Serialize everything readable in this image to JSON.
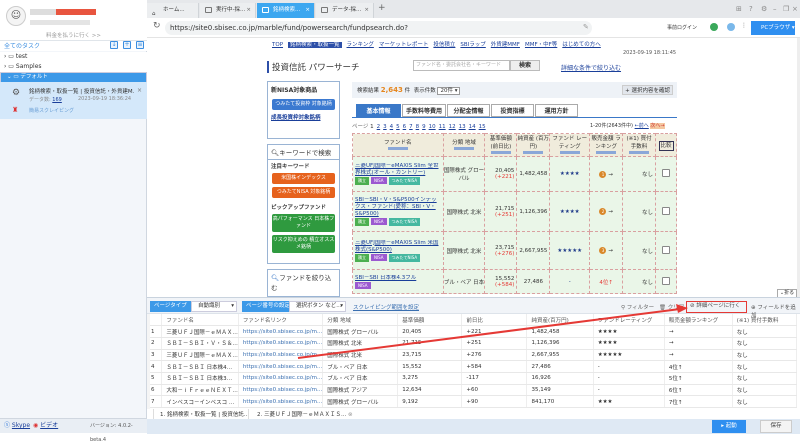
{
  "sidebar": {
    "pay_link": "料金を払うに行く >>",
    "all_tasks": "全てのタスク",
    "folders": [
      "test",
      "Samples",
      "デフォルト"
    ],
    "task": {
      "title": "銘柄検索・取扱一覧 | 投資信託・外貨建M...",
      "data_label": "データ数:",
      "data_count": "169",
      "time": "2023-09-19 18:36:24",
      "type": "簡易スクレイピング"
    },
    "skype": "Skype",
    "video": "ビデオ",
    "version": "バージョン: 4.0.2-beta.4"
  },
  "browser": {
    "tabs": [
      "ホーム...",
      "実行中-採...",
      "銘柄検索...",
      "データ-採..."
    ],
    "active_tab": 2,
    "url": "https://site0.sbisec.co.jp/marble/fund/powersearch/fundpsearch.do?",
    "prelogin": "事前ログイン",
    "pc_browser": "PCブラウザ"
  },
  "page": {
    "nav": [
      "TOP",
      "銘柄検索・取扱一覧",
      "ランキング",
      "マーケットレポート",
      "投信積立",
      "SBIラップ",
      "外貨建MMF",
      "MMF・中F等",
      "はじめての方へ"
    ],
    "date": "2023-09-19 18:11:45",
    "title": "投資信託 パワーサーチ",
    "search_placeholder": "ファンド名・委託会社名・キーワード",
    "search_btn": "検索",
    "detail_link": "詳細な条件で絞り込む",
    "nisa_title": "新NISA対象商品",
    "nisa_btn": "つみたて投資枠 対象銘柄",
    "growth_link": "成長投資枠対象銘柄",
    "keyword_title": "キーワードで検索",
    "attention": "注目キーワード",
    "kw_btns": [
      "米国株インデックス",
      "つみたてNISA 対象銘柄"
    ],
    "pickup": "ピックアップファンド",
    "pick_btns": [
      "高パフォーマンス 日本株ファンド",
      "リスク抑えめの 積立オススメ銘柄"
    ],
    "narrow": "ファンドを絞り込む",
    "result_label": "検索結果",
    "result_count": "2,643",
    "result_unit": "件",
    "display_label": "表示件数",
    "display_value": "20件",
    "confirm_btn": "選択内容を確認",
    "tabs": [
      "基本情報",
      "手数料等費用",
      "分配金情報",
      "投資指標",
      "運用方針"
    ],
    "pager_label": "ページ",
    "pages": [
      "1",
      "2",
      "3",
      "4",
      "5",
      "6",
      "7",
      "8",
      "9",
      "10",
      "11",
      "12",
      "13",
      "14",
      "15"
    ],
    "range": "1-20件(2643件中)",
    "prev": "←前へ",
    "next": "次へ→",
    "headers": [
      "ファンド名",
      "分類 地域",
      "基準価額 (前日比)",
      "純資産 (百万円)",
      "ファンド レーティング",
      "販売金額 ランキング",
      "(※1) 買付 手数料",
      "比較"
    ],
    "rows": [
      {
        "name": "三菱UFJ国際－eMAXIS Slim 全世界株式(オール・カントリー)",
        "badges": [
          "積立",
          "NISA",
          "つみたてNISA"
        ],
        "cat": "国際株式 グローバル",
        "price": "20,405",
        "chg": "(+221)",
        "assets": "1,482,458",
        "rating": "★★★★",
        "rank": "1",
        "arrow": "→",
        "fee": "なし"
      },
      {
        "name": "SBI－SBI・V・S&P500インデックス・ファンド(愛称：SBI・V・S&P500)",
        "badges": [
          "積立",
          "NISA",
          "つみたてNISA"
        ],
        "cat": "国際株式 北米",
        "price": "21,715",
        "chg": "(+251)",
        "assets": "1,126,396",
        "rating": "★★★★",
        "rank": "2",
        "arrow": "→",
        "fee": "なし"
      },
      {
        "name": "三菱UFJ国際－eMAXIS Slim 米国株式(S&P500)",
        "badges": [
          "積立",
          "NISA",
          "つみたてNISA"
        ],
        "cat": "国際株式 北米",
        "price": "23,715",
        "chg": "(+276)",
        "assets": "2,667,955",
        "rating": "★★★★★",
        "rank": "3",
        "arrow": "→",
        "fee": "なし"
      },
      {
        "name": "SBI－SBI 日本株4.3ブル",
        "badges": [
          "NISA"
        ],
        "cat": "ブル・ベア 日本",
        "price": "15,552",
        "chg": "(+584)",
        "assets": "27,486",
        "rating": "-",
        "rank": "4位↑",
        "arrow": "",
        "fee": "なし"
      }
    ]
  },
  "panel": {
    "page_type_label": "ページタイプ",
    "page_type": "自動識別",
    "pagenum_label": "ページ番号の設定",
    "pagenum": "選択ボタン など...",
    "scrape_link": "スクレイピング範囲を設定",
    "collapse": "折る",
    "filter": "フィルター",
    "clear": "クリア",
    "goto_detail": "詳細ページに行く",
    "add_field": "フィールドを追加",
    "columns": [
      "",
      "ファンド名",
      "ファンド名リンク",
      "分類 地域",
      "基準価額",
      "前日比",
      "純資産(百万円)",
      "ファンドレーティング",
      "販売金額ランキング",
      "(※1) 買付手数料"
    ],
    "rows": [
      [
        "1",
        "三菱ＵＦＪ国際－ｅＭＡＸ…",
        "https://site0.sbisec.co.jp/m...",
        "国際株式 グローバル",
        "20,405",
        "+221",
        "1,482,458",
        "★★★★",
        "→",
        "なし"
      ],
      [
        "2",
        "ＳＢＩ－ＳＢＩ・Ｖ・Ｓ＆…",
        "https://site0.sbisec.co.jp/m...",
        "国際株式 北米",
        "21,715",
        "+251",
        "1,126,396",
        "★★★★",
        "→",
        "なし"
      ],
      [
        "3",
        "三菱ＵＦＪ国際－ｅＭＡＸ…",
        "https://site0.sbisec.co.jp/m...",
        "国際株式 北米",
        "23,715",
        "+276",
        "2,667,955",
        "★★★★★",
        "→",
        "なし"
      ],
      [
        "4",
        "ＳＢＩ－ＳＢＩ 日本株4…",
        "https://site0.sbisec.co.jp/m...",
        "ブル・ベア 日本",
        "15,552",
        "+584",
        "27,486",
        "-",
        "4位↑",
        "なし"
      ],
      [
        "5",
        "ＳＢＩ－ＳＢＩ 日本株3…",
        "https://site0.sbisec.co.jp/m...",
        "ブル・ベア 日本",
        "3,275",
        "-117",
        "16,926",
        "-",
        "5位↑",
        "なし"
      ],
      [
        "6",
        "大和－ｉＦｒｅｅＮＥＸＴ…",
        "https://site0.sbisec.co.jp/m...",
        "国際株式 アジア",
        "12,634",
        "+60",
        "35,149",
        "-",
        "6位↑",
        "なし"
      ],
      [
        "7",
        "インベスコ－インベスコ …",
        "https://site0.sbisec.co.jp/m...",
        "国際株式 グローバル",
        "9,192",
        "+90",
        "841,170",
        "★★★",
        "7位↑",
        "なし"
      ]
    ],
    "bottom_tabs": [
      "1. 銘柄検索・取扱一覧 | 投資信託...",
      "2. 三菱ＵＦＪ国際－ｅＭＡＸＩＳ..."
    ],
    "start": "起動",
    "save": "保存"
  },
  "colors": {
    "accent": "#3c99e8",
    "highlight": "#e53935",
    "orange": "#e6621d"
  }
}
